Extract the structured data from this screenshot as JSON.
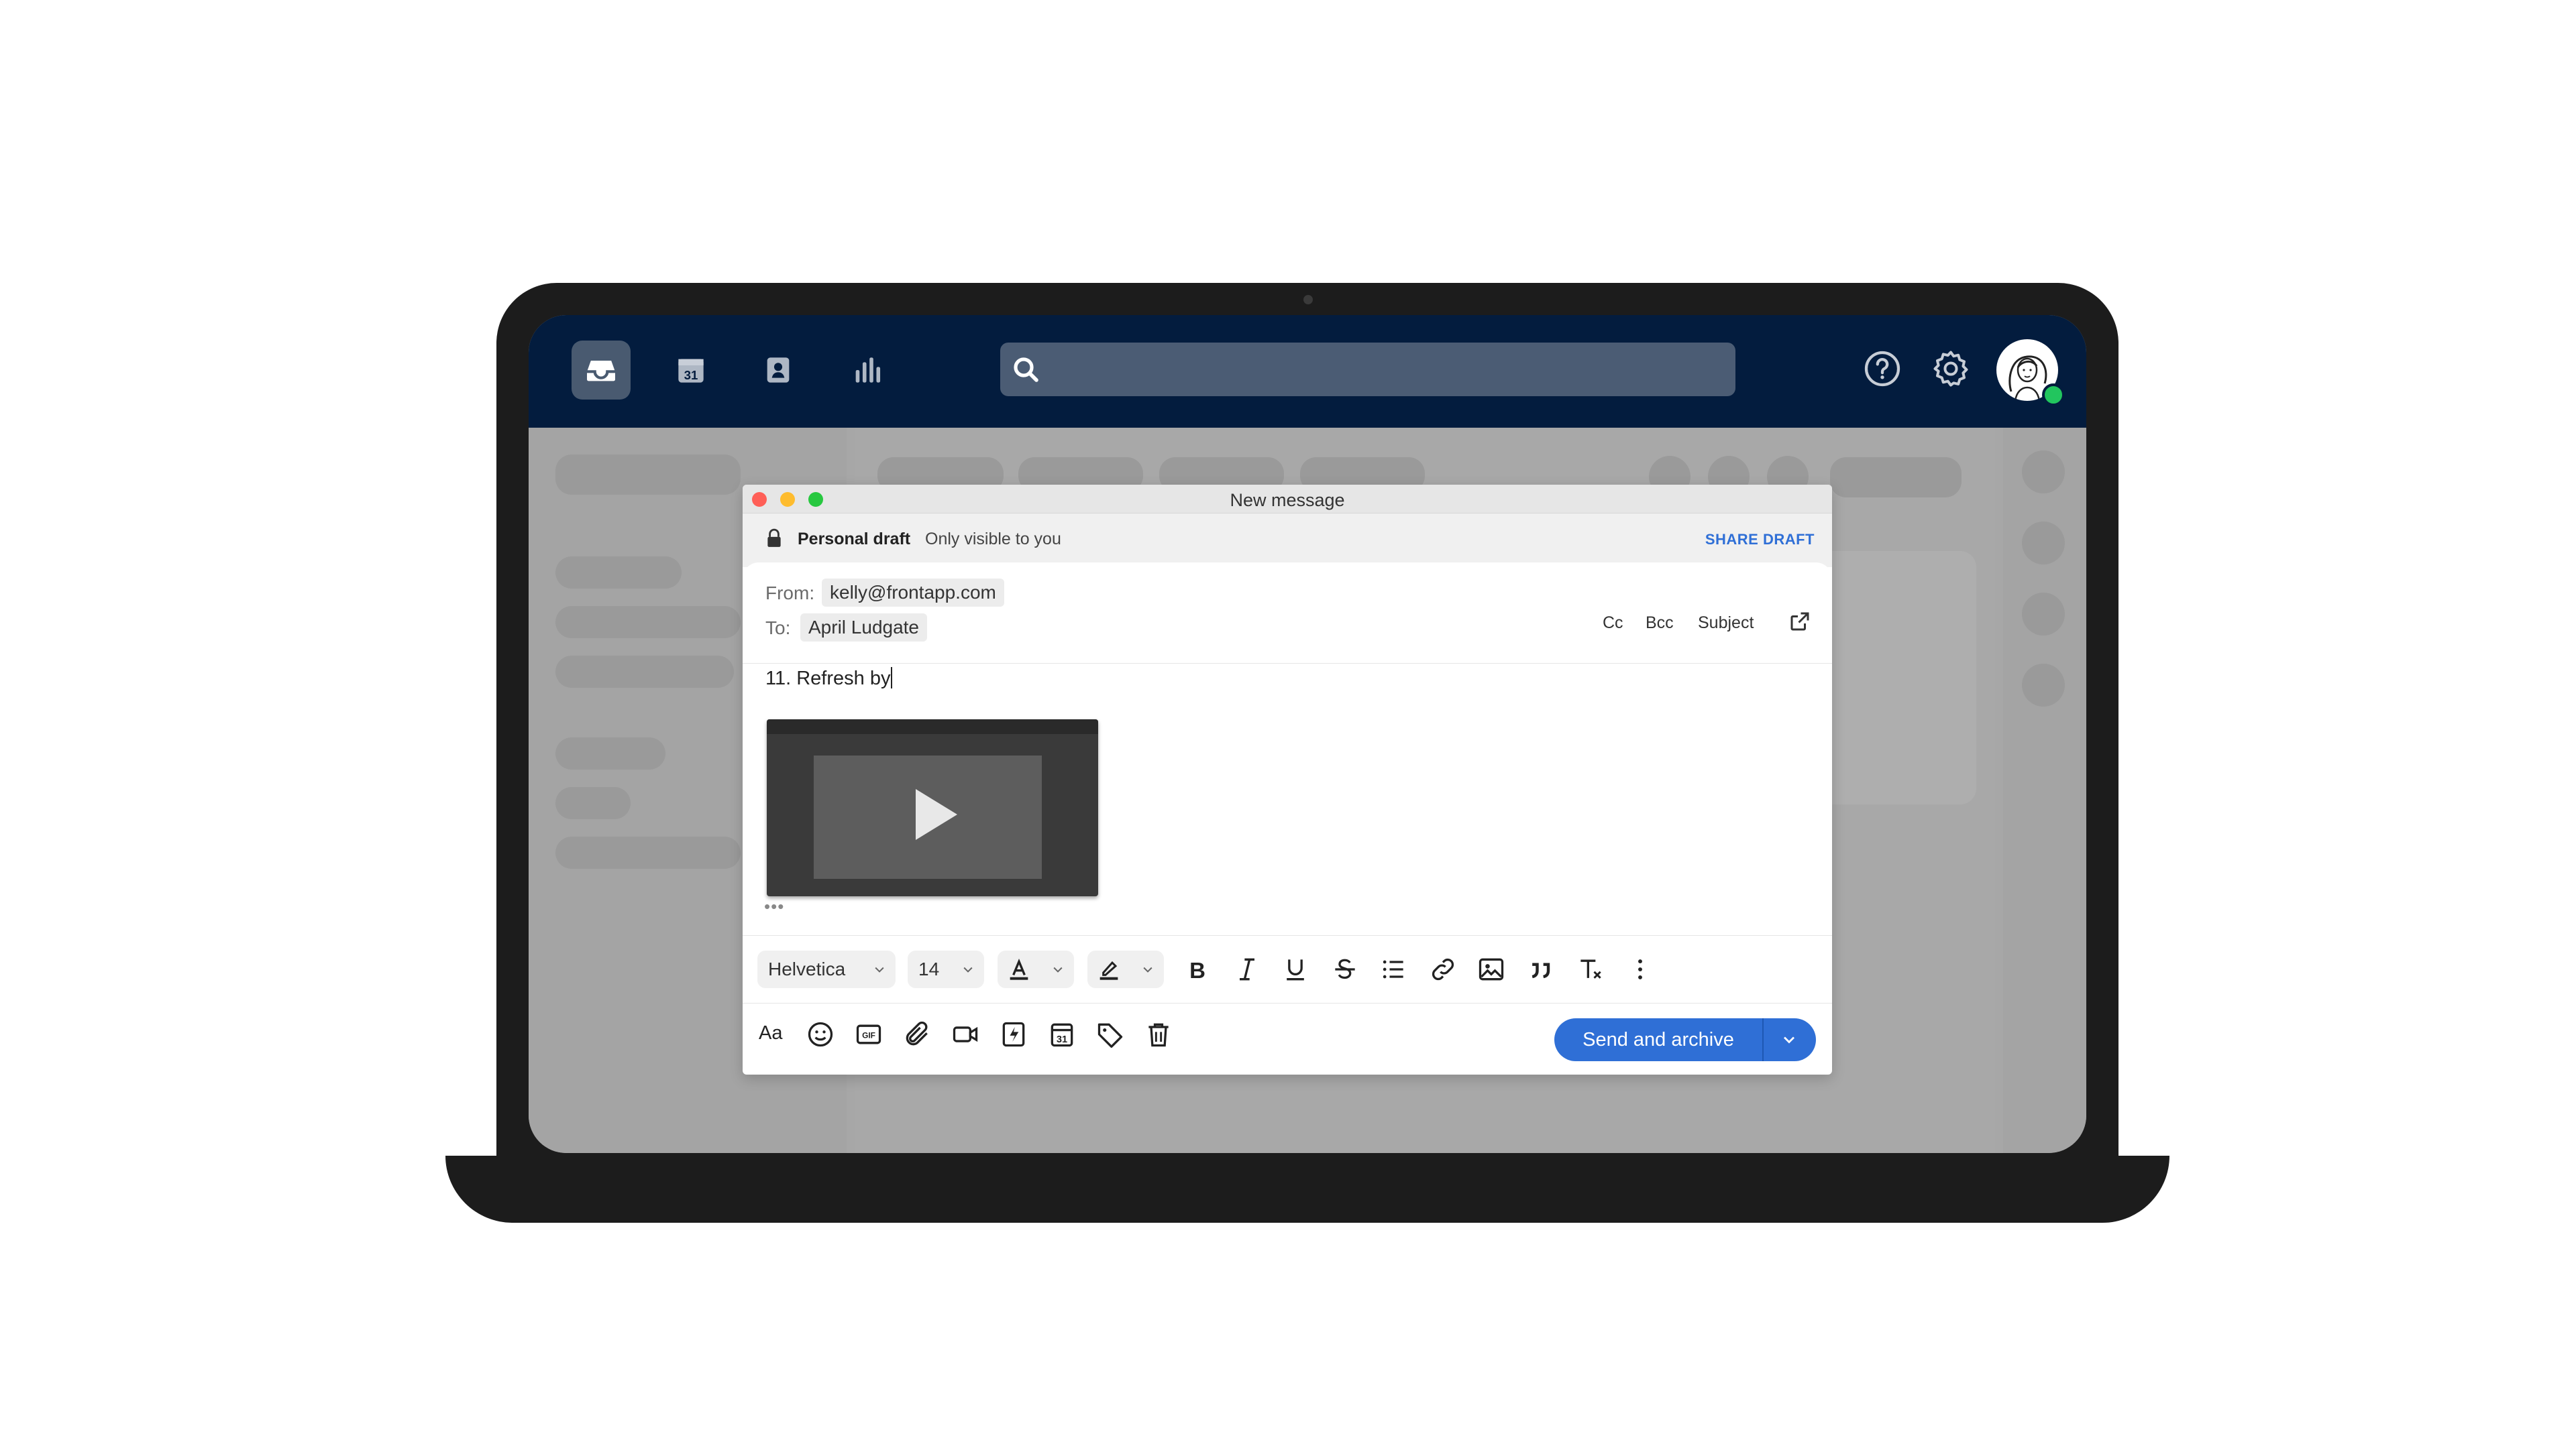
{
  "colors": {
    "topbar": "#031c3e",
    "accent": "#2f6fd6",
    "online": "#22c55e",
    "traffic_red": "#ff5f57",
    "traffic_yellow": "#febc2e",
    "traffic_green": "#28c840"
  },
  "topbar": {
    "nav_icons": [
      "inbox-icon",
      "calendar-icon",
      "contacts-icon",
      "analytics-icon"
    ],
    "calendar_day": "31",
    "search_placeholder": "",
    "right_icons": [
      "help-icon",
      "gear-icon",
      "avatar"
    ]
  },
  "composer": {
    "window_title": "New message",
    "draft": {
      "label": "Personal draft",
      "visibility": "Only visible to you",
      "share_label": "SHARE DRAFT"
    },
    "from_label": "From:",
    "from_value": "kelly@frontapp.com",
    "to_label": "To:",
    "to_value": "April Ludgate",
    "header_links": {
      "cc": "Cc",
      "bcc": "Bcc",
      "subject": "Subject"
    },
    "body_text": "11. Refresh by",
    "ellipsis": "•••",
    "format_toolbar": {
      "font": "Helvetica",
      "size": "14",
      "icons": [
        "text-color-icon",
        "highlight-icon",
        "bold-icon",
        "italic-icon",
        "underline-icon",
        "strikethrough-icon",
        "list-icon",
        "link-icon",
        "image-icon",
        "quote-icon",
        "clear-format-icon",
        "more-icon"
      ]
    },
    "bottom_toolbar": {
      "format_toggle_label": "Aa",
      "gif_label": "GIF",
      "calendar_day": "31",
      "icons": [
        "emoji-icon",
        "gif-icon",
        "attach-icon",
        "video-icon",
        "snippet-icon",
        "calendar-icon",
        "tag-icon",
        "trash-icon"
      ],
      "send_label": "Send and archive"
    }
  }
}
